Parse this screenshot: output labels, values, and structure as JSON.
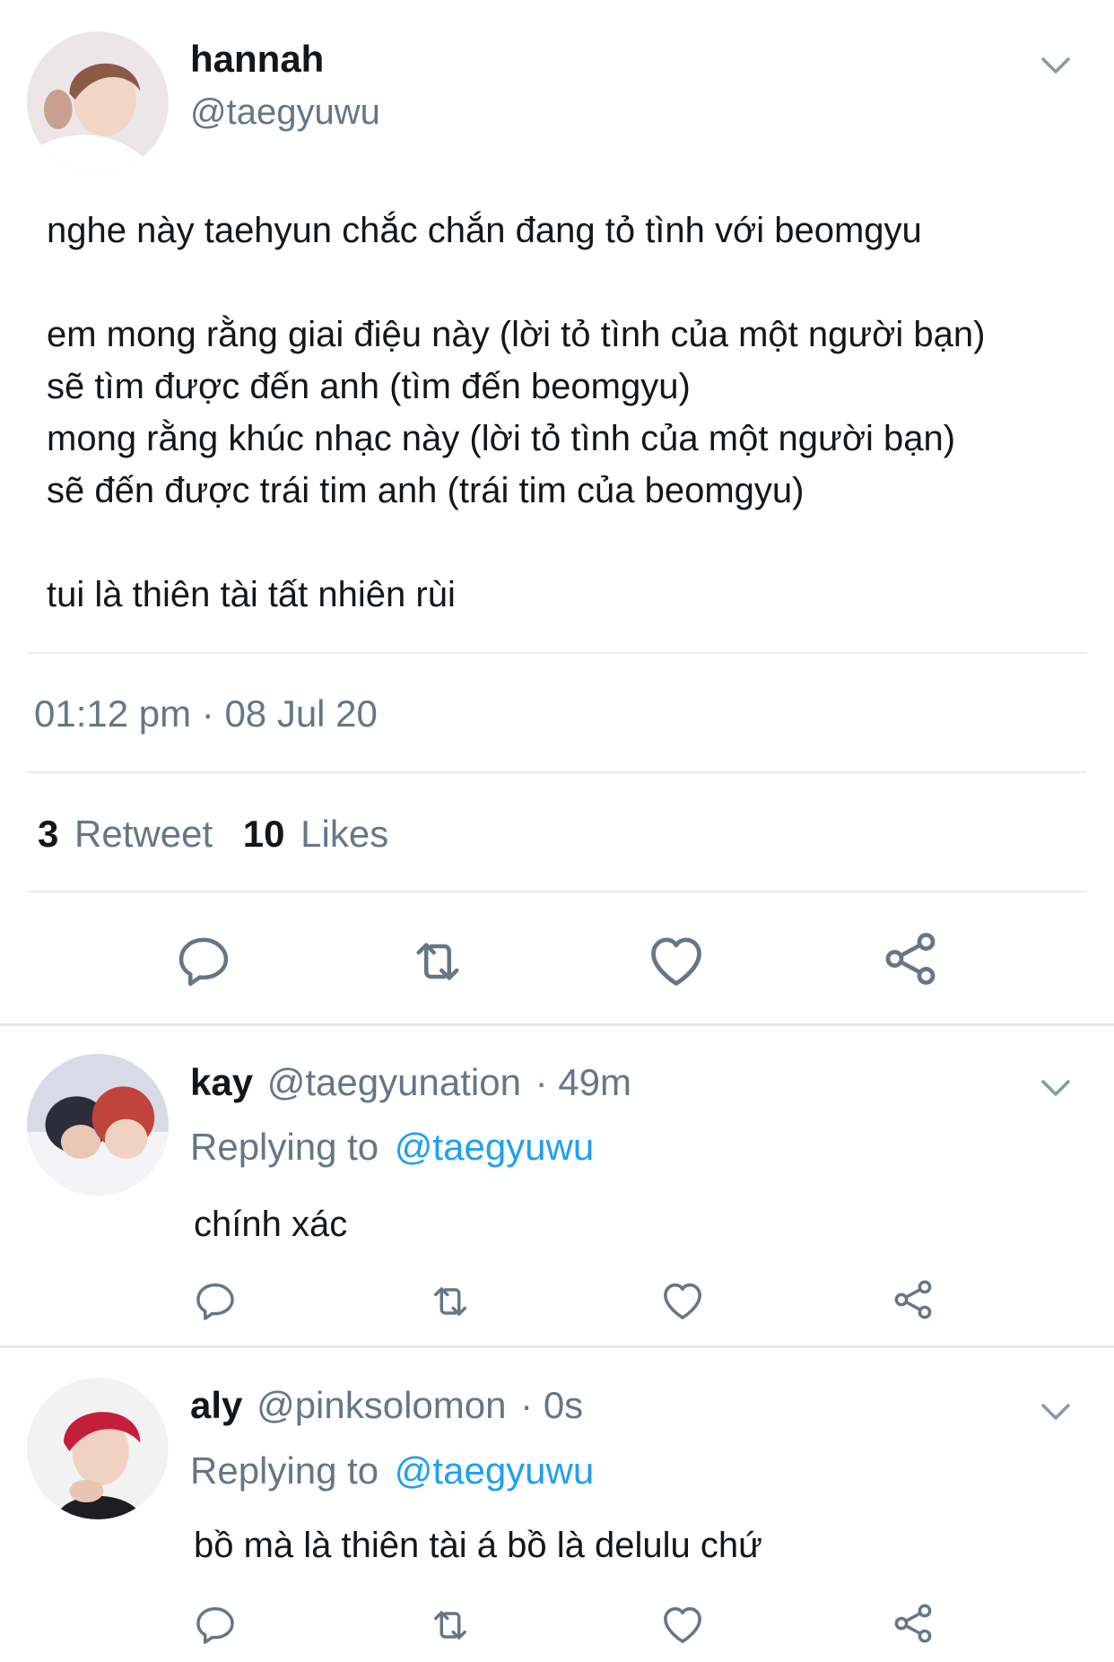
{
  "tweet": {
    "author_name": "hannah",
    "author_handle": "@taegyuwu",
    "text": "nghe này taehyun chắc chắn đang tỏ tình với beomgyu\n\nem mong rằng giai điệu này (lời tỏ tình của một người bạn)\nsẽ tìm được đến anh (tìm đến beomgyu)\nmong rằng khúc nhạc này (lời tỏ tình của một người bạn)\nsẽ đến được trái tim anh (trái tim của beomgyu)\n\ntui là thiên tài tất nhiên rùi",
    "timestamp": "01:12 pm · 08 Jul 20",
    "retweet_count": "3",
    "retweet_label": "Retweet",
    "likes_count": "10",
    "likes_label": "Likes"
  },
  "replies": [
    {
      "name": "kay",
      "handle": "@taegyunation",
      "time": "· 49m",
      "replying_prefix": "Replying to",
      "replying_to": "@taegyuwu",
      "text": "chính xác"
    },
    {
      "name": "aly",
      "handle": "@pinksolomon",
      "time": "· 0s",
      "replying_prefix": "Replying to",
      "replying_to": "@taegyuwu",
      "text": "bồ mà là thiên tài á bồ là delulu chứ"
    }
  ],
  "icons": {
    "reply": "reply-icon",
    "retweet": "retweet-icon",
    "like": "heart-icon",
    "share": "share-icon",
    "more": "chevron-down-icon"
  },
  "colors": {
    "link": "#1da1f2",
    "secondary_text": "#657786",
    "divider": "#e6ecf0"
  }
}
